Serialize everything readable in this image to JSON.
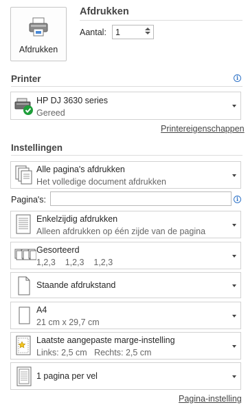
{
  "print": {
    "button_label": "Afdrukken",
    "heading": "Afdrukken",
    "copies_label": "Aantal:",
    "copies_value": "1"
  },
  "printer": {
    "heading": "Printer",
    "name": "HP DJ 3630 series",
    "status": "Gereed",
    "properties_link": "Printereigenschappen"
  },
  "settings": {
    "heading": "Instellingen",
    "pages_label": "Pagina's:",
    "pages_value": "",
    "items": [
      {
        "title": "Alle pagina's afdrukken",
        "subtitle": "Het volledige document afdrukken",
        "icon": "pages-icon"
      },
      {
        "title": "Enkelzijdig afdrukken",
        "subtitle": "Alleen afdrukken op één zijde van de pagina",
        "icon": "one-sided-icon"
      },
      {
        "title": "Gesorteerd",
        "subtitle": "1,2,3    1,2,3    1,2,3",
        "icon": "collated-icon"
      },
      {
        "title": "Staande afdrukstand",
        "subtitle": "",
        "icon": "portrait-icon"
      },
      {
        "title": "A4",
        "subtitle": "21 cm x 29,7 cm",
        "icon": "paper-size-icon"
      },
      {
        "title": "Laatste aangepaste marge-instelling",
        "subtitle_left_label": "Links:",
        "subtitle_left_value": "2,5 cm",
        "subtitle_right_label": "Rechts:",
        "subtitle_right_value": "2,5 cm",
        "icon": "margins-icon"
      },
      {
        "title": "1 pagina per vel",
        "subtitle": "",
        "icon": "pages-per-sheet-icon"
      }
    ],
    "page_setup_link": "Pagina-instelling"
  },
  "colors": {
    "accent_info": "#2f73c7",
    "status_ok": "#1e9e3a",
    "border": "#d2d2d2"
  }
}
